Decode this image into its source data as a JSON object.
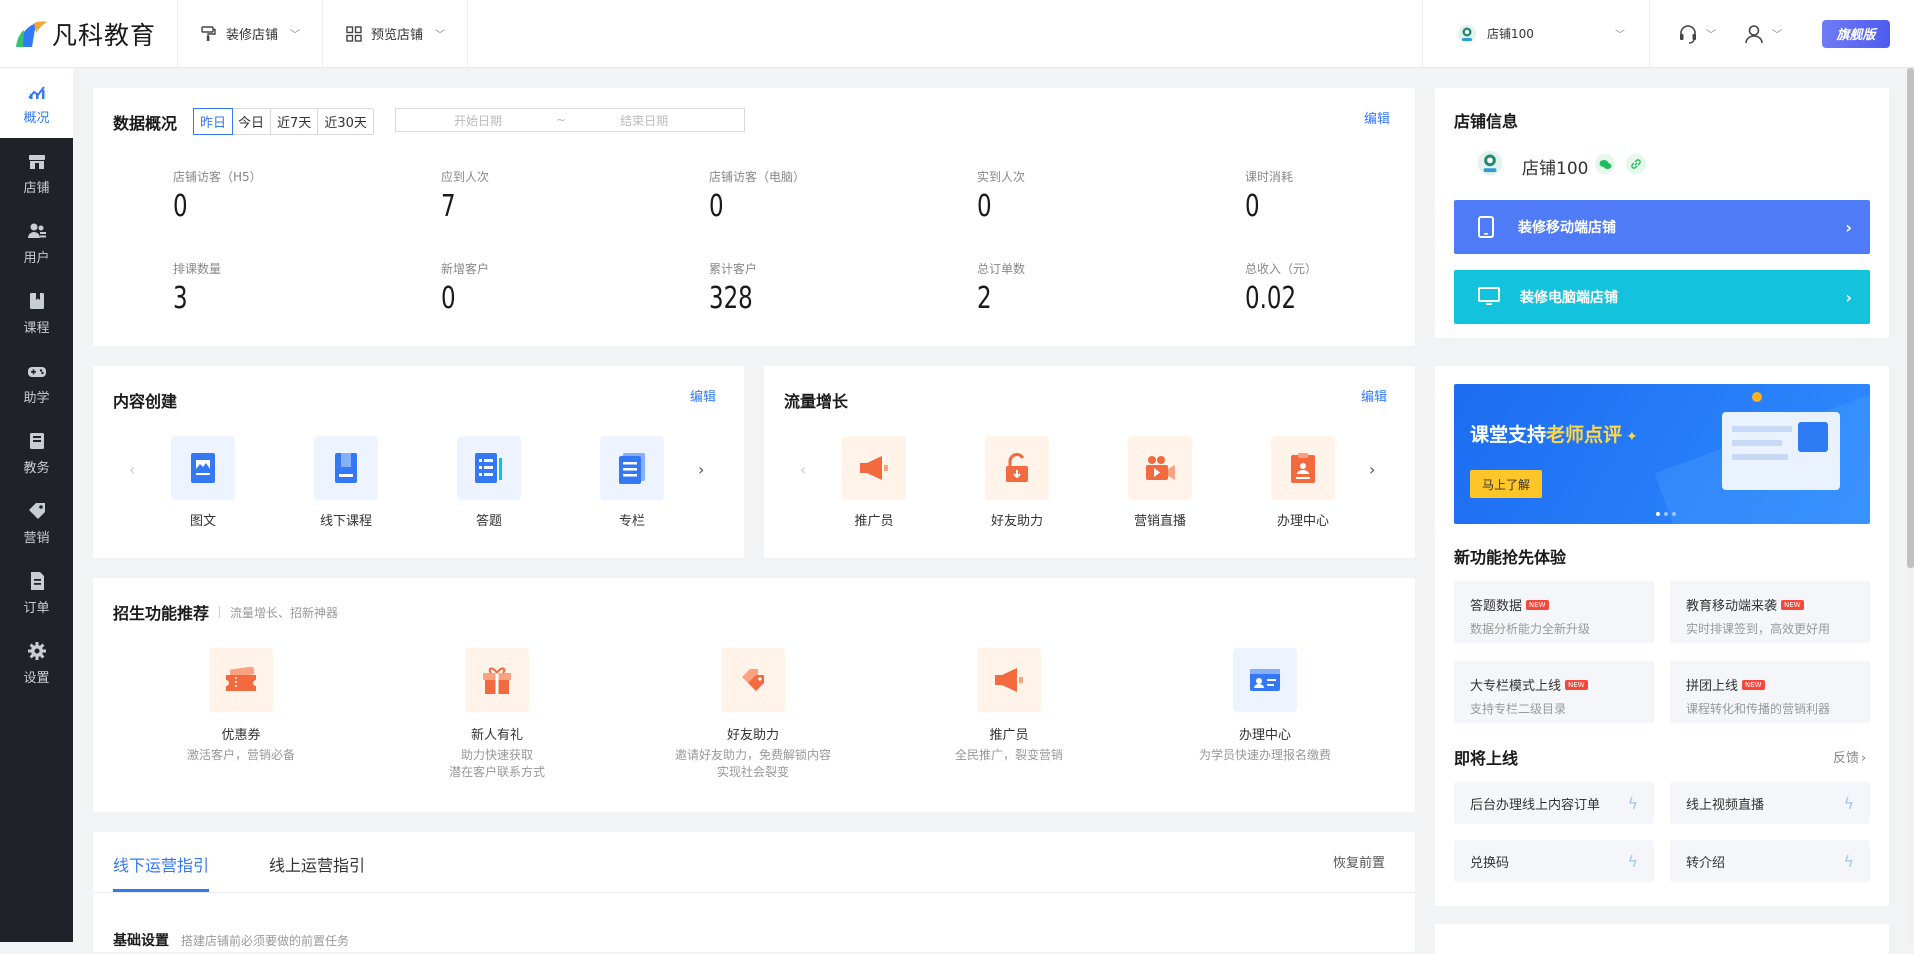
{
  "logo": {
    "text": "凡科教育"
  },
  "top_menu": [
    {
      "label": "装修店铺",
      "icon": "paint-roller-icon"
    },
    {
      "label": "预览店铺",
      "icon": "grid-icon"
    }
  ],
  "shop_select": {
    "name": "店铺100"
  },
  "edition_badge": "旗舰版",
  "sidebar": [
    {
      "label": "概况",
      "icon": "chart-icon",
      "active": true
    },
    {
      "label": "店铺",
      "icon": "shop-icon"
    },
    {
      "label": "用户",
      "icon": "users-icon"
    },
    {
      "label": "课程",
      "icon": "book-icon"
    },
    {
      "label": "助学",
      "icon": "gamepad-icon"
    },
    {
      "label": "教务",
      "icon": "notebook-icon"
    },
    {
      "label": "营销",
      "icon": "tag-icon"
    },
    {
      "label": "订单",
      "icon": "order-icon"
    },
    {
      "label": "设置",
      "icon": "gear-icon"
    }
  ],
  "overview": {
    "title": "数据概况",
    "date_tabs": [
      "昨日",
      "今日",
      "近7天",
      "近30天"
    ],
    "start_placeholder": "开始日期",
    "range_sep": "~",
    "end_placeholder": "结束日期",
    "edit": "编辑",
    "stats": [
      {
        "label": "店铺访客（H5）",
        "value": "0"
      },
      {
        "label": "应到人次",
        "value": "7"
      },
      {
        "label": "店铺访客（电脑）",
        "value": "0"
      },
      {
        "label": "实到人次",
        "value": "0"
      },
      {
        "label": "课时消耗",
        "value": "0"
      },
      {
        "label": "排课数量",
        "value": "3"
      },
      {
        "label": "新增客户",
        "value": "0"
      },
      {
        "label": "累计客户",
        "value": "328"
      },
      {
        "label": "总订单数",
        "value": "2"
      },
      {
        "label": "总收入（元）",
        "value": "0.02"
      }
    ]
  },
  "content_create": {
    "title": "内容创建",
    "edit": "编辑",
    "items": [
      "图文",
      "线下课程",
      "答题",
      "专栏"
    ]
  },
  "traffic": {
    "title": "流量增长",
    "edit": "编辑",
    "items": [
      "推广员",
      "好友助力",
      "营销直播",
      "办理中心"
    ]
  },
  "recruit": {
    "title": "招生功能推荐",
    "subtitle": "流量增长、招新神器",
    "items": [
      {
        "title": "优惠券",
        "desc1": "激活客户，营销必备",
        "desc2": ""
      },
      {
        "title": "新人有礼",
        "desc1": "助力快速获取",
        "desc2": "潜在客户联系方式"
      },
      {
        "title": "好友助力",
        "desc1": "邀请好友助力，免费解锁内容",
        "desc2": "实现社会裂变"
      },
      {
        "title": "推广员",
        "desc1": "全民推广，裂变营销",
        "desc2": ""
      },
      {
        "title": "办理中心",
        "desc1": "为学员快速办理报名缴费",
        "desc2": ""
      }
    ]
  },
  "guide": {
    "tabs": [
      "线下运营指引",
      "线上运营指引"
    ],
    "restore": "恢复前置",
    "section": "基础设置",
    "section_desc": "搭建店铺前必须要做的前置任务"
  },
  "shop_info": {
    "title": "店铺信息",
    "name": "店铺100",
    "btn_mobile": "装修移动端店铺",
    "btn_pc": "装修电脑端店铺"
  },
  "banner": {
    "text_a": "课堂支持",
    "text_b": "老师点评",
    "button": "马上了解"
  },
  "new_features": {
    "title": "新功能抢先体验",
    "new_tag": "NEW",
    "items": [
      {
        "title": "答题数据",
        "desc": "数据分析能力全新升级"
      },
      {
        "title": "教育移动端来袭",
        "desc": "实时排课签到，高效更好用"
      },
      {
        "title": "大专栏模式上线",
        "desc": "支持专栏二级目录"
      },
      {
        "title": "拼团上线",
        "desc": "课程转化和传播的营销利器"
      }
    ]
  },
  "coming_soon": {
    "title": "即将上线",
    "feedback": "反馈",
    "items": [
      "后台办理线上内容订单",
      "线上视频直播",
      "兑换码",
      "转介绍"
    ]
  },
  "colors": {
    "accent": "#3478f6",
    "sidebar_bg": "#1f2329",
    "orange": "#f26a3d",
    "cyan": "#13c2dd"
  }
}
